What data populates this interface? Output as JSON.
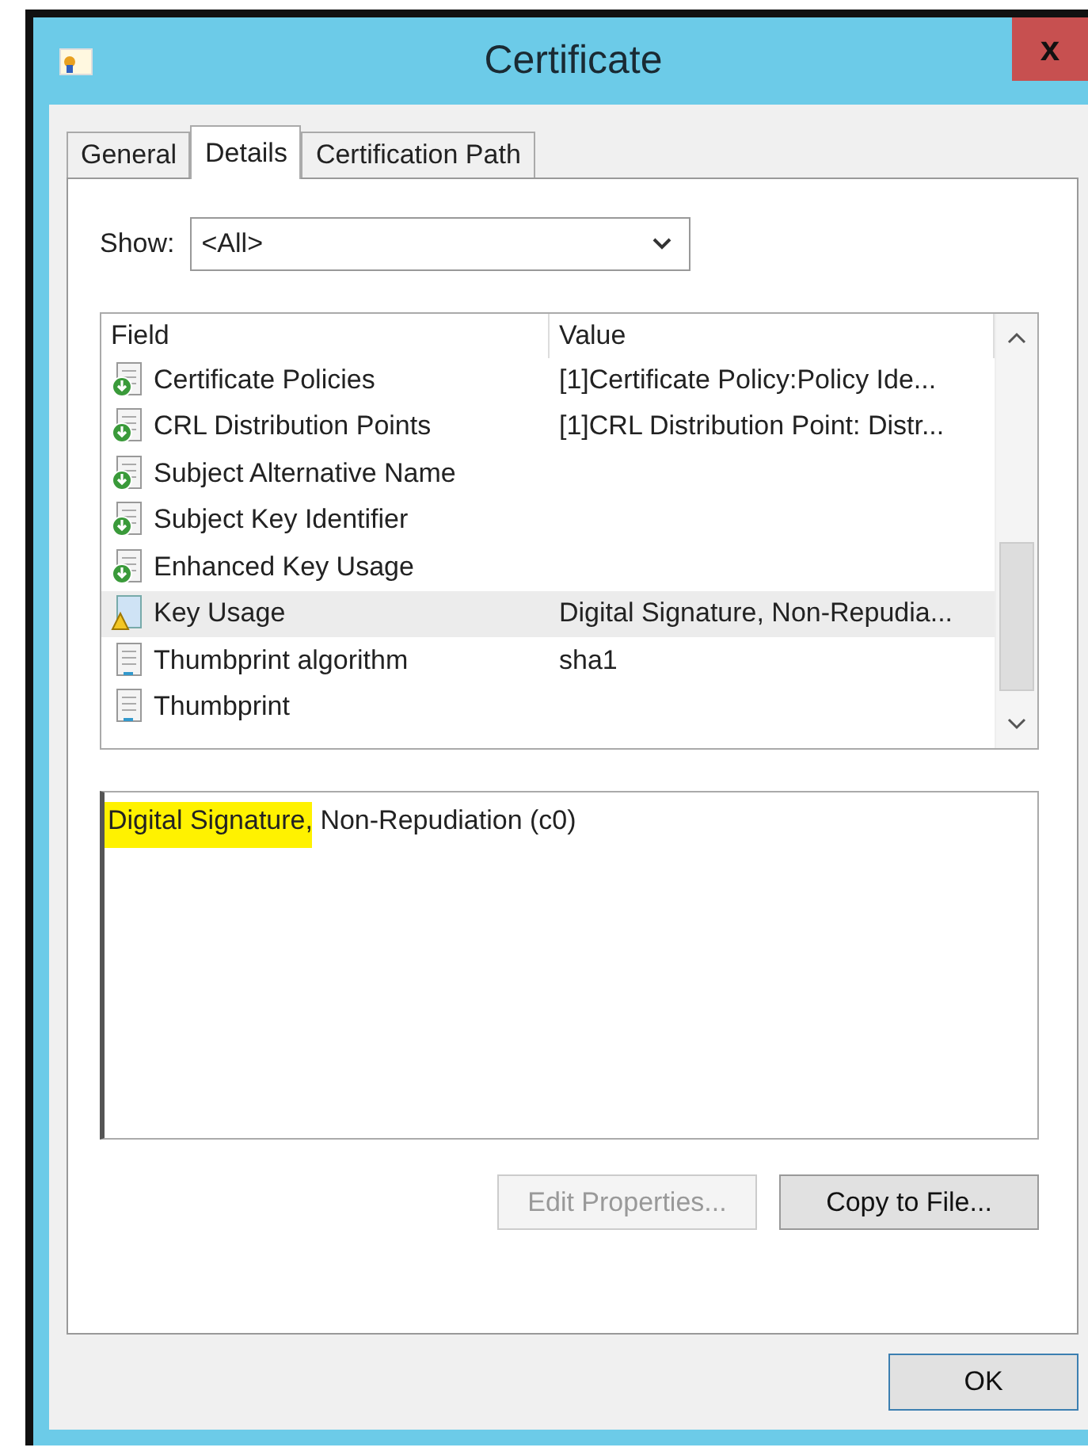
{
  "window": {
    "title": "Certificate",
    "close": "x"
  },
  "tabs": [
    {
      "label": "General",
      "selected": false
    },
    {
      "label": "Details",
      "selected": true
    },
    {
      "label": "Certification Path",
      "selected": false
    }
  ],
  "show": {
    "label": "Show:",
    "value": "<All>"
  },
  "table": {
    "columns": [
      "Field",
      "Value"
    ],
    "rows": [
      {
        "kind": "extension",
        "field": "Certificate Policies",
        "value": "[1]Certificate Policy:Policy Ide...",
        "selected": false
      },
      {
        "kind": "extension",
        "field": "CRL Distribution Points",
        "value": "[1]CRL Distribution Point: Distr...",
        "selected": false
      },
      {
        "kind": "extension",
        "field": "Subject Alternative Name",
        "selected": false
      },
      {
        "kind": "extension",
        "field": "Subject Key Identifier",
        "selected": false
      },
      {
        "kind": "extension",
        "field": "Enhanced Key Usage",
        "selected": false
      },
      {
        "kind": "warning",
        "field": "Key Usage",
        "value": "Digital Signature, Non-Repudia...",
        "selected": true
      },
      {
        "kind": "property",
        "field": "Thumbprint algorithm",
        "value": "sha1",
        "selected": false
      },
      {
        "kind": "property",
        "field": "Thumbprint",
        "selected": false
      }
    ]
  },
  "detail": [
    {
      "text": "Digital Signature,",
      "highlighted": true
    },
    {
      "text": "Non-Repudiation (c0)",
      "highlighted": false
    }
  ],
  "buttons": [
    {
      "label": "Edit Properties...",
      "disabled": true
    },
    {
      "label": "Copy to File...",
      "disabled": false
    }
  ],
  "ok_button": "OK"
}
